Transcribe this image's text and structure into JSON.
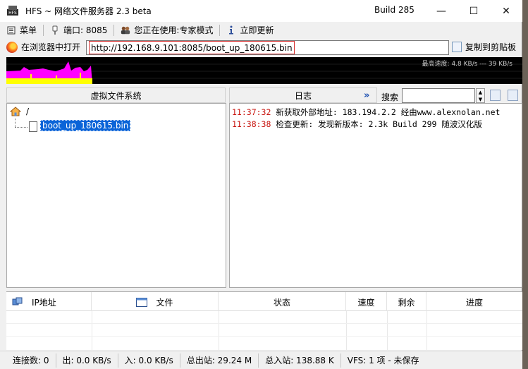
{
  "window": {
    "title": "HFS ~ 网络文件服务器 2.3 beta",
    "build": "Build 285",
    "min_label": "—",
    "max_label": "☐",
    "close_label": "✕"
  },
  "toolbar": {
    "menu": "菜单",
    "port": "端口: 8085",
    "mode": "您正在使用:专家模式",
    "update": "立即更新"
  },
  "address": {
    "open_in_browser": "在浏览器中打开",
    "url": "http://192.168.9.101:8085/boot_up_180615.bin",
    "copy_clipboard": "复制到剪贴板"
  },
  "graph": {
    "label": "最高速度: 4.8 KB/s --- 39 KB/s",
    "colors": {
      "background": "#000000",
      "upload": "#ff00ff",
      "download": "#ffff00"
    }
  },
  "vfs": {
    "header": "虚拟文件系统",
    "root": "/",
    "file": "boot_up_180615.bin"
  },
  "log": {
    "header": "日志",
    "search_label": "搜索",
    "search_value": "",
    "entries": [
      {
        "time": "11:37:32",
        "text": "新获取外部地址: 183.194.2.2 经由www.alexnolan.net"
      },
      {
        "time": "11:38:38",
        "text": "检查更新: 发现新版本: 2.3k Build 299 随波汉化版"
      }
    ]
  },
  "connections": {
    "columns": [
      "IP地址",
      "文件",
      "状态",
      "速度",
      "剩余",
      "进度"
    ]
  },
  "status": {
    "connections": "连接数: 0",
    "out": "出: 0.0 KB/s",
    "in": "入: 0.0 KB/s",
    "total_out": "总出站: 29.24 M",
    "total_in": "总入站: 138.88 K",
    "vfs": "VFS: 1 项 - 未保存"
  },
  "colors": {
    "accent": "#0a64d8",
    "log_time": "#c8150f",
    "url_highlight": "#d42b2b"
  }
}
